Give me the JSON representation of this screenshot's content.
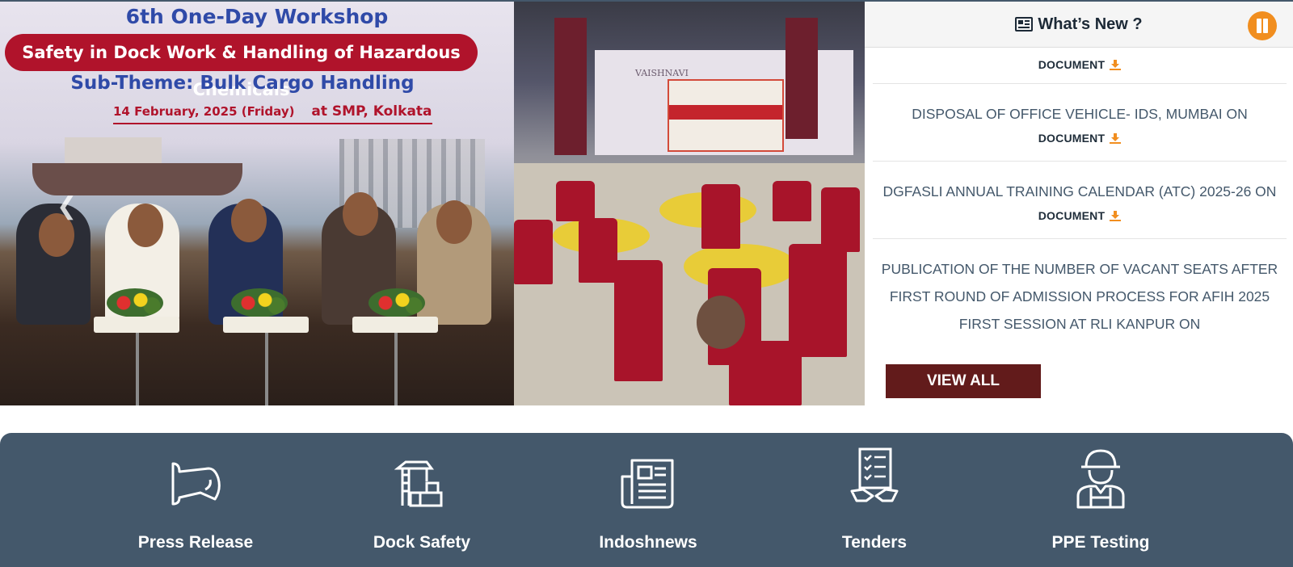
{
  "slider": {
    "banner": {
      "line1": "6th One-Day Workshop",
      "line2": "Safety in Dock Work & Handling of Hazardous Chemicals",
      "line3": "Sub-Theme: Bulk Cargo Handling",
      "date": "14 February, 2025 (Friday)",
      "venue": "at SMP, Kolkata"
    },
    "auditorium_sign": "VAISHNAVI",
    "prev_icon": "chevron-left-icon"
  },
  "whats_new": {
    "title": "What’s New ?",
    "title_icon": "newspaper-icon",
    "pause_icon": "pause-icon",
    "accent_color": "#f18e1f",
    "items": [
      {
        "text": "",
        "link": "DOCUMENT"
      },
      {
        "text": "DISPOSAL OF OFFICE VEHICLE- IDS, MUMBAI ON",
        "link": "DOCUMENT"
      },
      {
        "text": "DGFASLI ANNUAL TRAINING CALENDAR (ATC) 2025-26 ON",
        "link": "DOCUMENT"
      },
      {
        "text": "PUBLICATION OF THE NUMBER OF VACANT SEATS AFTER FIRST ROUND OF ADMISSION PROCESS FOR AFIH 2025 FIRST SESSION AT RLI KANPUR ON",
        "link": ""
      }
    ],
    "view_all": "VIEW ALL",
    "view_all_color": "#621b1b"
  },
  "quick_links": {
    "background": "#44586b",
    "items": [
      {
        "label": "Press Release",
        "icon": "megaphone-icon"
      },
      {
        "label": "Dock Safety",
        "icon": "crane-icon"
      },
      {
        "label": "Indoshnews",
        "icon": "newspaper-icon"
      },
      {
        "label": "Tenders",
        "icon": "tender-handshake-icon"
      },
      {
        "label": "PPE Testing",
        "icon": "worker-helmet-icon"
      }
    ]
  }
}
